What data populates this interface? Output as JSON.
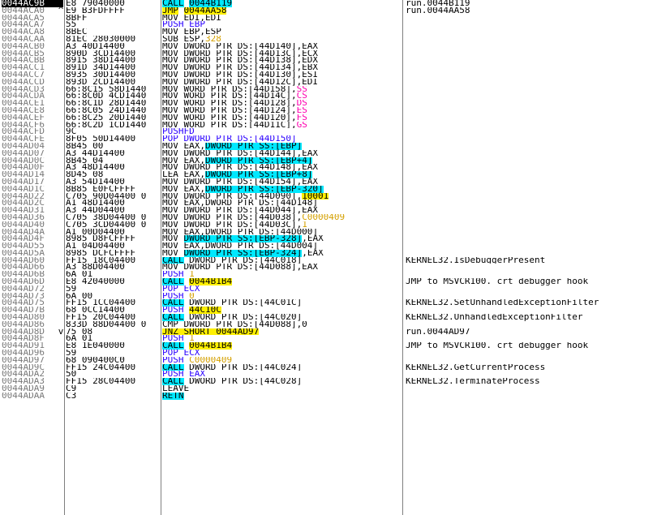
{
  "colors": {
    "call_bg": "#00e8ff",
    "jump_bg": "#fff000",
    "push_fg": "#2a00ff",
    "literal_fg": "#d4a000",
    "segment_fg": "#ff00b0",
    "address_fg": "#7a7a7a",
    "selected_bg": "#000000"
  },
  "rows": [
    {
      "addr": "0044AC9B",
      "mark": "",
      "hex": "E8 79040000",
      "dis": [
        {
          "t": "CALL",
          "c": "call"
        },
        {
          "t": " "
        },
        {
          "t": "0044B119",
          "c": "call"
        }
      ],
      "cmt": "run.0044B119",
      "sel": true
    },
    {
      "addr": "0044ACA0",
      "mark": "^",
      "hex": "E9 B3FDFFFF",
      "dis": [
        {
          "t": "JMP",
          "c": "jmp"
        },
        {
          "t": " "
        },
        {
          "t": "0044AA58",
          "c": "jmp"
        }
      ],
      "cmt": "run.0044AA58"
    },
    {
      "addr": "0044ACA5",
      "mark": "",
      "hex": "8BFF",
      "dis": [
        {
          "t": "MOV EDI,EDI"
        }
      ],
      "cmt": ""
    },
    {
      "addr": "0044ACA7",
      "mark": "",
      "hex": "55",
      "dis": [
        {
          "t": "PUSH EBP",
          "c": "push"
        }
      ],
      "cmt": ""
    },
    {
      "addr": "0044ACA8",
      "mark": "",
      "hex": "8BEC",
      "dis": [
        {
          "t": "MOV EBP,ESP"
        }
      ],
      "cmt": ""
    },
    {
      "addr": "0044ACAA",
      "mark": "",
      "hex": "81EC 28030000",
      "dis": [
        {
          "t": "SUB ESP,"
        },
        {
          "t": "328",
          "c": "lit"
        }
      ],
      "cmt": ""
    },
    {
      "addr": "0044ACB0",
      "mark": "",
      "hex": "A3 40D14400",
      "dis": [
        {
          "t": "MOV DWORD PTR DS:[44D140],EAX"
        }
      ],
      "cmt": ""
    },
    {
      "addr": "0044ACB5",
      "mark": "",
      "hex": "890D 3CD14400",
      "dis": [
        {
          "t": "MOV DWORD PTR DS:[44D13C],ECX"
        }
      ],
      "cmt": ""
    },
    {
      "addr": "0044ACBB",
      "mark": "",
      "hex": "8915 38D14400",
      "dis": [
        {
          "t": "MOV DWORD PTR DS:[44D138],EDX"
        }
      ],
      "cmt": ""
    },
    {
      "addr": "0044ACC1",
      "mark": "",
      "hex": "891D 34D14400",
      "dis": [
        {
          "t": "MOV DWORD PTR DS:[44D134],EBX"
        }
      ],
      "cmt": ""
    },
    {
      "addr": "0044ACC7",
      "mark": "",
      "hex": "8935 30D14400",
      "dis": [
        {
          "t": "MOV DWORD PTR DS:[44D130],ESI"
        }
      ],
      "cmt": ""
    },
    {
      "addr": "0044ACCD",
      "mark": "",
      "hex": "893D 2CD14400",
      "dis": [
        {
          "t": "MOV DWORD PTR DS:[44D12C],EDI"
        }
      ],
      "cmt": ""
    },
    {
      "addr": "0044ACD3",
      "mark": "",
      "hex": "66:8C15 58D1440",
      "dis": [
        {
          "t": "MOV WORD PTR DS:[44D158],"
        },
        {
          "t": "SS",
          "c": "seg"
        }
      ],
      "cmt": ""
    },
    {
      "addr": "0044ACDA",
      "mark": "",
      "hex": "66:8C0D 4CD1440",
      "dis": [
        {
          "t": "MOV WORD PTR DS:[44D14C],"
        },
        {
          "t": "CS",
          "c": "seg"
        }
      ],
      "cmt": ""
    },
    {
      "addr": "0044ACE1",
      "mark": "",
      "hex": "66:8C1D 28D1440",
      "dis": [
        {
          "t": "MOV WORD PTR DS:[44D128],"
        },
        {
          "t": "DS",
          "c": "seg"
        }
      ],
      "cmt": ""
    },
    {
      "addr": "0044ACE8",
      "mark": "",
      "hex": "66:8C05 24D1440",
      "dis": [
        {
          "t": "MOV WORD PTR DS:[44D124],"
        },
        {
          "t": "ES",
          "c": "seg"
        }
      ],
      "cmt": ""
    },
    {
      "addr": "0044ACEF",
      "mark": "",
      "hex": "66:8C25 20D1440",
      "dis": [
        {
          "t": "MOV WORD PTR DS:[44D120],"
        },
        {
          "t": "FS",
          "c": "seg"
        }
      ],
      "cmt": ""
    },
    {
      "addr": "0044ACF6",
      "mark": "",
      "hex": "66:8C2D 1CD1440",
      "dis": [
        {
          "t": "MOV WORD PTR DS:[44D11C],"
        },
        {
          "t": "GS",
          "c": "seg"
        }
      ],
      "cmt": ""
    },
    {
      "addr": "0044ACFD",
      "mark": "",
      "hex": "9C",
      "dis": [
        {
          "t": "PUSHFD",
          "c": "push"
        }
      ],
      "cmt": ""
    },
    {
      "addr": "0044ACFE",
      "mark": "",
      "hex": "8F05 50D14400",
      "dis": [
        {
          "t": "POP DWORD PTR DS:[44D150]",
          "c": "push"
        }
      ],
      "cmt": ""
    },
    {
      "addr": "0044AD04",
      "mark": "",
      "hex": "8B45 00",
      "dis": [
        {
          "t": "MOV EAX,"
        },
        {
          "t": "DWORD PTR SS:[EBP]",
          "c": "mem"
        }
      ],
      "cmt": ""
    },
    {
      "addr": "0044AD07",
      "mark": "",
      "hex": "A3 44D14400",
      "dis": [
        {
          "t": "MOV DWORD PTR DS:[44D144],EAX"
        }
      ],
      "cmt": ""
    },
    {
      "addr": "0044AD0C",
      "mark": "",
      "hex": "8B45 04",
      "dis": [
        {
          "t": "MOV EAX,"
        },
        {
          "t": "DWORD PTR SS:[EBP+4]",
          "c": "mem"
        }
      ],
      "cmt": ""
    },
    {
      "addr": "0044AD0F",
      "mark": "",
      "hex": "A3 48D14400",
      "dis": [
        {
          "t": "MOV DWORD PTR DS:[44D148],EAX"
        }
      ],
      "cmt": ""
    },
    {
      "addr": "0044AD14",
      "mark": "",
      "hex": "8D45 08",
      "dis": [
        {
          "t": "LEA EAX,"
        },
        {
          "t": "DWORD PTR SS:[EBP+8]",
          "c": "mem"
        }
      ],
      "cmt": ""
    },
    {
      "addr": "0044AD17",
      "mark": "",
      "hex": "A3 54D14400",
      "dis": [
        {
          "t": "MOV DWORD PTR DS:[44D154],EAX"
        }
      ],
      "cmt": ""
    },
    {
      "addr": "0044AD1C",
      "mark": "",
      "hex": "8B85 E0FCFFFF",
      "dis": [
        {
          "t": "MOV EAX,"
        },
        {
          "t": "DWORD PTR SS:[EBP-320]",
          "c": "mem"
        }
      ],
      "cmt": ""
    },
    {
      "addr": "0044AD22",
      "mark": "",
      "hex": "C705 90D04400 0",
      "dis": [
        {
          "t": "MOV DWORD PTR DS:[44D090],"
        },
        {
          "t": "10001",
          "c": "hl"
        }
      ],
      "cmt": ""
    },
    {
      "addr": "0044AD2C",
      "mark": "",
      "hex": "A1 48D14400",
      "dis": [
        {
          "t": "MOV EAX,DWORD PTR DS:[44D148]"
        }
      ],
      "cmt": ""
    },
    {
      "addr": "0044AD31",
      "mark": "",
      "hex": "A3 44D04400",
      "dis": [
        {
          "t": "MOV DWORD PTR DS:[44D044],EAX"
        }
      ],
      "cmt": ""
    },
    {
      "addr": "0044AD36",
      "mark": "",
      "hex": "C705 38D04400 0",
      "dis": [
        {
          "t": "MOV DWORD PTR DS:[44D038],"
        },
        {
          "t": "C0000409",
          "c": "lit"
        }
      ],
      "cmt": ""
    },
    {
      "addr": "0044AD40",
      "mark": "",
      "hex": "C705 3CD04400 0",
      "dis": [
        {
          "t": "MOV DWORD PTR DS:[44D03C],"
        },
        {
          "t": "1",
          "c": "lit"
        }
      ],
      "cmt": ""
    },
    {
      "addr": "0044AD4A",
      "mark": "",
      "hex": "A1 00D04400",
      "dis": [
        {
          "t": "MOV EAX,DWORD PTR DS:[44D000]"
        }
      ],
      "cmt": ""
    },
    {
      "addr": "0044AD4F",
      "mark": "",
      "hex": "8985 D8FCFFFF",
      "dis": [
        {
          "t": "MOV "
        },
        {
          "t": "DWORD PTR SS:[EBP-328]",
          "c": "mem"
        },
        {
          "t": ",EAX"
        }
      ],
      "cmt": ""
    },
    {
      "addr": "0044AD55",
      "mark": "",
      "hex": "A1 04D04400",
      "dis": [
        {
          "t": "MOV EAX,DWORD PTR DS:[44D004]"
        }
      ],
      "cmt": ""
    },
    {
      "addr": "0044AD5A",
      "mark": "",
      "hex": "8985 DCFCFFFF",
      "dis": [
        {
          "t": "MOV "
        },
        {
          "t": "DWORD PTR SS:[EBP-324]",
          "c": "mem"
        },
        {
          "t": ",EAX"
        }
      ],
      "cmt": ""
    },
    {
      "addr": "0044AD60",
      "mark": "",
      "hex": "FF15 18C04400",
      "dis": [
        {
          "t": "CALL",
          "c": "call"
        },
        {
          "t": " DWORD PTR DS:[44C018]"
        }
      ],
      "cmt": "KERNEL32.IsDebuggerPresent"
    },
    {
      "addr": "0044AD66",
      "mark": "",
      "hex": "A3 88D04400",
      "dis": [
        {
          "t": "MOV DWORD PTR DS:[44D088],EAX"
        }
      ],
      "cmt": ""
    },
    {
      "addr": "0044AD6B",
      "mark": "",
      "hex": "6A 01",
      "dis": [
        {
          "t": "PUSH ",
          "c": "push"
        },
        {
          "t": "1",
          "c": "lit"
        }
      ],
      "cmt": ""
    },
    {
      "addr": "0044AD6D",
      "mark": "",
      "hex": "E8 42040000",
      "dis": [
        {
          "t": "CALL",
          "c": "call"
        },
        {
          "t": " "
        },
        {
          "t": "0044B1B4",
          "c": "jmp"
        }
      ],
      "cmt": "JMP to MSVCR100._crt_debugger_hook"
    },
    {
      "addr": "0044AD72",
      "mark": "",
      "hex": "59",
      "dis": [
        {
          "t": "POP ECX",
          "c": "push"
        }
      ],
      "cmt": ""
    },
    {
      "addr": "0044AD73",
      "mark": "",
      "hex": "6A 00",
      "dis": [
        {
          "t": "PUSH ",
          "c": "push"
        },
        {
          "t": "0",
          "c": "lit"
        }
      ],
      "cmt": ""
    },
    {
      "addr": "0044AD75",
      "mark": "",
      "hex": "FF15 1CC04400",
      "dis": [
        {
          "t": "CALL",
          "c": "call"
        },
        {
          "t": " DWORD PTR DS:[44C01C]"
        }
      ],
      "cmt": "KERNEL32.SetUnhandledExceptionFilter"
    },
    {
      "addr": "0044AD7B",
      "mark": "",
      "hex": "68 0CC14400",
      "dis": [
        {
          "t": "PUSH ",
          "c": "push"
        },
        {
          "t": "44C10C",
          "c": "jmp"
        }
      ],
      "cmt": ""
    },
    {
      "addr": "0044AD80",
      "mark": "",
      "hex": "FF15 20C04400",
      "dis": [
        {
          "t": "CALL",
          "c": "call"
        },
        {
          "t": " DWORD PTR DS:[44C020]"
        }
      ],
      "cmt": "KERNEL32.UnhandledExceptionFilter"
    },
    {
      "addr": "0044AD86",
      "mark": "",
      "hex": "833D 88D04400 0",
      "dis": [
        {
          "t": "CMP DWORD PTR DS:[44D088],0"
        }
      ],
      "cmt": ""
    },
    {
      "addr": "0044AD8D",
      "mark": "v",
      "hex": "75 08",
      "dis": [
        {
          "t": "JNZ SHORT 0044AD97",
          "c": "jmp"
        }
      ],
      "cmt": "run.0044AD97"
    },
    {
      "addr": "0044AD8F",
      "mark": "",
      "hex": "6A 01",
      "dis": [
        {
          "t": "PUSH ",
          "c": "push"
        },
        {
          "t": "1",
          "c": "lit"
        }
      ],
      "cmt": ""
    },
    {
      "addr": "0044AD91",
      "mark": "",
      "hex": "E8 1E040000",
      "dis": [
        {
          "t": "CALL",
          "c": "call"
        },
        {
          "t": " "
        },
        {
          "t": "0044B1B4",
          "c": "jmp"
        }
      ],
      "cmt": "JMP to MSVCR100._crt_debugger_hook"
    },
    {
      "addr": "0044AD96",
      "mark": "",
      "hex": "59",
      "dis": [
        {
          "t": "POP ECX",
          "c": "push"
        }
      ],
      "cmt": ""
    },
    {
      "addr": "0044AD97",
      "mark": "",
      "hex": "68 090400C0",
      "dis": [
        {
          "t": "PUSH ",
          "c": "push"
        },
        {
          "t": "C0000409",
          "c": "lit"
        }
      ],
      "cmt": ""
    },
    {
      "addr": "0044AD9C",
      "mark": "",
      "hex": "FF15 24C04400",
      "dis": [
        {
          "t": "CALL",
          "c": "call"
        },
        {
          "t": " DWORD PTR DS:[44C024]"
        }
      ],
      "cmt": "KERNEL32.GetCurrentProcess"
    },
    {
      "addr": "0044ADA2",
      "mark": "",
      "hex": "50",
      "dis": [
        {
          "t": "PUSH EAX",
          "c": "push"
        }
      ],
      "cmt": ""
    },
    {
      "addr": "0044ADA3",
      "mark": "",
      "hex": "FF15 28C04400",
      "dis": [
        {
          "t": "CALL",
          "c": "call"
        },
        {
          "t": " DWORD PTR DS:[44C028]"
        }
      ],
      "cmt": "KERNEL32.TerminateProcess"
    },
    {
      "addr": "0044ADA9",
      "mark": "",
      "hex": "C9",
      "dis": [
        {
          "t": "LEAVE"
        }
      ],
      "cmt": ""
    },
    {
      "addr": "0044ADAA",
      "mark": "",
      "hex": "C3",
      "dis": [
        {
          "t": "RETN",
          "c": "call"
        }
      ],
      "cmt": ""
    }
  ]
}
